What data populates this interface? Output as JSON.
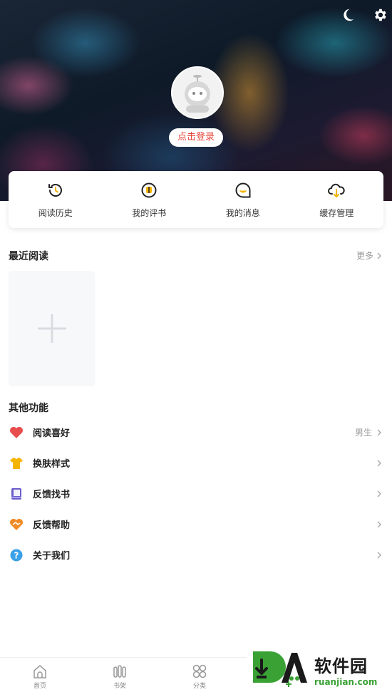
{
  "header": {
    "login_label": "点击登录",
    "night_mode_icon": "moon-icon",
    "settings_icon": "gear-icon"
  },
  "quick_actions": [
    {
      "label": "阅读历史",
      "icon": "history-clock-icon"
    },
    {
      "label": "我的评书",
      "icon": "comment-book-icon"
    },
    {
      "label": "我的消息",
      "icon": "message-bubble-icon"
    },
    {
      "label": "缓存管理",
      "icon": "cloud-download-icon"
    }
  ],
  "recent": {
    "title": "最近阅读",
    "more_label": "更多"
  },
  "other": {
    "title": "其他功能",
    "items": [
      {
        "label": "阅读喜好",
        "value": "男生",
        "icon": "heart-icon",
        "color": "#e84d4d"
      },
      {
        "label": "换肤样式",
        "value": "",
        "icon": "tshirt-icon",
        "color": "#f5b400"
      },
      {
        "label": "反馈找书",
        "value": "",
        "icon": "book-icon",
        "color": "#6b5cc9"
      },
      {
        "label": "反馈帮助",
        "value": "",
        "icon": "helping-heart-icon",
        "color": "#f08a24"
      },
      {
        "label": "关于我们",
        "value": "",
        "icon": "question-icon",
        "color": "#3aa0e8"
      }
    ]
  },
  "bottom_nav": [
    {
      "label": "首页",
      "icon": "home-icon"
    },
    {
      "label": "书架",
      "icon": "bookshelf-icon"
    },
    {
      "label": "分类",
      "icon": "category-grid-icon"
    }
  ],
  "watermark": {
    "cn": "软件园",
    "en": "ruanjian.com"
  },
  "colors": {
    "accent_red": "#e5453a",
    "watermark_green": "#3aa235",
    "muted_text": "#999999"
  }
}
